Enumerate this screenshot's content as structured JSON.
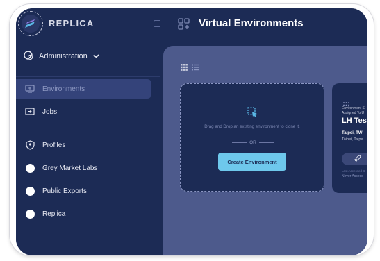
{
  "app": {
    "brand": "REPLICA"
  },
  "header": {
    "title": "Virtual Environments"
  },
  "sidebar": {
    "admin_label": "Administration",
    "items": [
      {
        "label": "Environments",
        "icon": "monitor-icon",
        "active": true
      },
      {
        "label": "Jobs",
        "icon": "jobs-icon",
        "active": false
      },
      {
        "label": "Profiles",
        "icon": "profile-shield-icon",
        "active": false
      },
      {
        "label": "Grey Market Labs",
        "icon": "dot-icon",
        "active": false
      },
      {
        "label": "Public Exports",
        "icon": "dot-icon",
        "active": false
      },
      {
        "label": "Replica",
        "icon": "dot-icon",
        "active": false
      }
    ]
  },
  "dropzone": {
    "text": "Drag and Drop an existing environment to clone it.",
    "or": "OR",
    "button": "Create Environment"
  },
  "env_card": {
    "line1": "Environment S",
    "line2": "Assigned To U",
    "name": "LH Test",
    "location_bold": "Taipei, TW",
    "location": "Taipei, Taipe",
    "last_accessed_label": "Last Accessed B",
    "last_accessed": "Never Access"
  },
  "colors": {
    "sidebar": "#1c2b55",
    "content": "#4d5a8c",
    "accent": "#6ec8ec",
    "active": "#34437a"
  }
}
